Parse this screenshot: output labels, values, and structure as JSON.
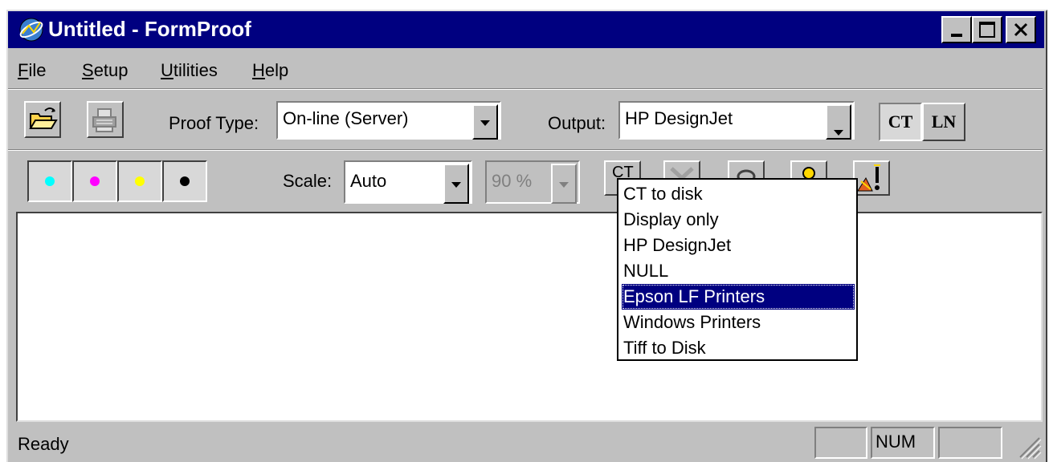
{
  "window": {
    "title": "Untitled - FormProof",
    "buttons": [
      "minimize",
      "maximize",
      "close"
    ]
  },
  "menubar": {
    "items": [
      {
        "label": "File",
        "mnemonic": "F"
      },
      {
        "label": "Setup",
        "mnemonic": "S"
      },
      {
        "label": "Utilities",
        "mnemonic": "U"
      },
      {
        "label": "Help",
        "mnemonic": "H"
      }
    ]
  },
  "toolbar1": {
    "open_icon": "open-folder-icon",
    "print_icon": "printer-icon",
    "proof_type_label": "Proof Type:",
    "proof_type_value": "On-line (Server)",
    "output_label": "Output:",
    "output_value": "HP DesignJet",
    "ct_label": "CT",
    "ln_label": "LN"
  },
  "toolbar2": {
    "inks": [
      {
        "name": "cyan",
        "color": "#00ffff"
      },
      {
        "name": "magenta",
        "color": "#ff00ff"
      },
      {
        "name": "yellow",
        "color": "#ffff00"
      },
      {
        "name": "black",
        "color": "#000000"
      }
    ],
    "scale_label": "Scale:",
    "scale_value": "Auto",
    "zoom_value": "90 %",
    "ct_partial_label": "CT"
  },
  "dropdown": {
    "items": [
      "CT to disk",
      "Display only",
      "HP DesignJet",
      "NULL",
      "Epson LF Printers",
      "Windows Printers",
      "Tiff to Disk"
    ],
    "selected": "Epson LF Printers"
  },
  "statusbar": {
    "text": "Ready",
    "num": "NUM"
  },
  "colors": {
    "titlebar": "#000080",
    "face": "#c0c0c0",
    "selection": "#000080"
  }
}
